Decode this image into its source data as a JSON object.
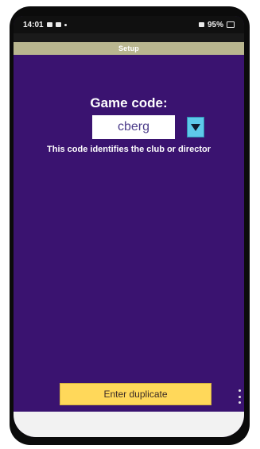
{
  "status_bar": {
    "time": "14:01",
    "right_text": "95%"
  },
  "app_name": "",
  "titlebar": {
    "title": "Setup"
  },
  "main": {
    "game_code_label": "Game code:",
    "game_code_value": "cberg",
    "hint": "This code identifies the club or director",
    "enter_button_label": "Enter duplicate"
  },
  "icons": {
    "dropdown": "triangle-down-icon",
    "menu": "more-vertical-icon"
  },
  "colors": {
    "background": "#3a1370",
    "titlebar": "#b9b68f",
    "dropdown": "#5ec9ea",
    "button": "#ffd85a"
  }
}
